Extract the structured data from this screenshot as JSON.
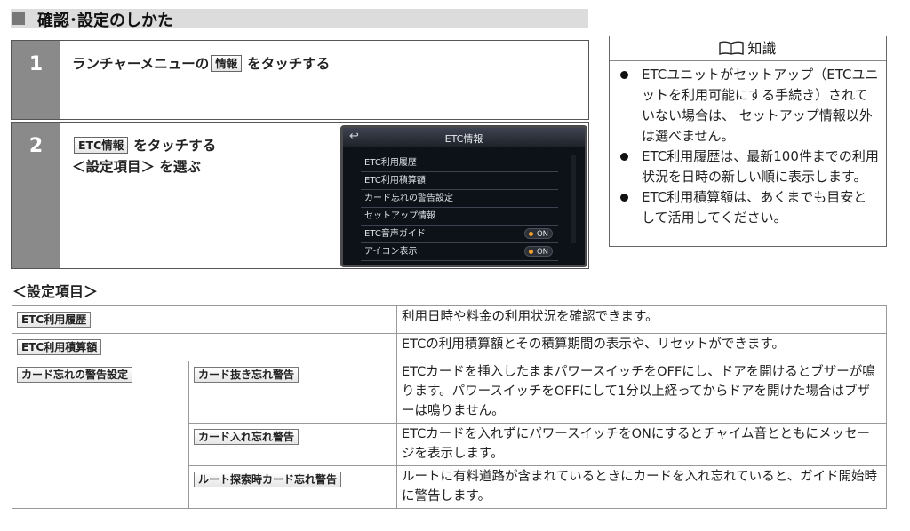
{
  "section": {
    "title": "確認･設定のしかた"
  },
  "step1": {
    "number": "1",
    "text_before": "ランチャーメニューの",
    "button": "情報",
    "text_after": "をタッチする"
  },
  "step2": {
    "number": "2",
    "button": "ETC情報",
    "text_after": "をタッチする",
    "line2": "＜設定項目＞ を選ぶ"
  },
  "screen": {
    "back_icon": "↩",
    "title": "ETC情報",
    "items": [
      {
        "label": "ETC利用履歴"
      },
      {
        "label": "ETC利用積算額"
      },
      {
        "label": "カード忘れの警告設定"
      },
      {
        "label": "セットアップ情報"
      },
      {
        "label": "ETC音声ガイド",
        "toggle": "ON"
      },
      {
        "label": "アイコン表示",
        "toggle": "ON"
      }
    ],
    "toggle_dot_color": "#f3a12a"
  },
  "knowledge": {
    "title": "知識",
    "icon": "book-icon",
    "items": [
      "ETCユニットがセットアップ（ETCユニットを利用可能にする手続き）されていない場合は、 セットアップ情報以外は選べません。",
      "ETC利用履歴は、最新100件までの利用状況を日時の新しい順に表示します。",
      "ETC利用積算額は、あくまでも目安として活用してください。"
    ]
  },
  "settings": {
    "heading": "＜設定項目＞",
    "rows": [
      {
        "label": "ETC利用履歴",
        "desc": "利用日時や料金の利用状況を確認できます。"
      },
      {
        "label": "ETC利用積算額",
        "desc": "ETCの利用積算額とその積算期間の表示や、リセットができます。"
      },
      {
        "label": "カード忘れの警告設定",
        "sub": "カード抜き忘れ警告",
        "desc": "ETCカードを挿入したままパワースイッチをOFFにし、ドアを開けるとブザーが鳴ります。パワースイッチをOFFにして1分以上経ってからドアを開けた場合はブザーは鳴りません。"
      },
      {
        "sub": "カード入れ忘れ警告",
        "desc": "ETCカードを入れずにパワースイッチをONにするとチャイム音とともにメッセージを表示します。"
      },
      {
        "sub": "ルート探索時カード忘れ警告",
        "desc": "ルートに有料道路が含まれているときにカードを入れ忘れていると、ガイド開始時に警告します。"
      }
    ]
  }
}
